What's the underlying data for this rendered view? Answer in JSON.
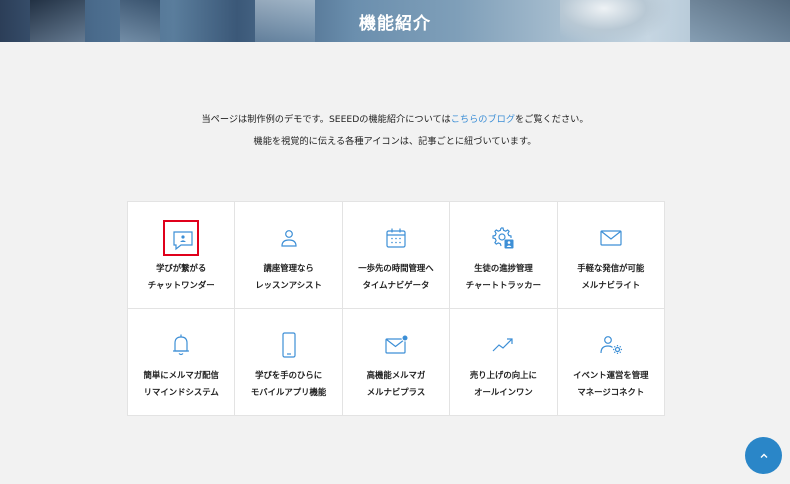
{
  "banner": {
    "title": "機能紹介"
  },
  "intro": {
    "line1_before": "当ページは制作例のデモです。SEEEDの機能紹介については",
    "line1_link": "こちらのブログ",
    "line1_after": "をご覧ください。",
    "line2": "機能を視覚的に伝える各種アイコンは、記事ごとに紐づいています。"
  },
  "features": [
    {
      "line1": "学びが繋がる",
      "line2": "チャットワンダー",
      "icon": "chat-user-icon"
    },
    {
      "line1": "講座管理なら",
      "line2": "レッスンアシスト",
      "icon": "user-icon"
    },
    {
      "line1": "一歩先の時間管理へ",
      "line2": "タイムナビゲータ",
      "icon": "calendar-icon"
    },
    {
      "line1": "生徒の進捗管理",
      "line2": "チャートトラッカー",
      "icon": "gear-user-icon"
    },
    {
      "line1": "手軽な発信が可能",
      "line2": "メルナビライト",
      "icon": "mail-icon"
    },
    {
      "line1": "簡単にメルマガ配信",
      "line2": "リマインドシステム",
      "icon": "bell-icon"
    },
    {
      "line1": "学びを手のひらに",
      "line2": "モバイルアプリ機能",
      "icon": "smartphone-icon"
    },
    {
      "line1": "高機能メルマガ",
      "line2": "メルナビプラス",
      "icon": "mail-notification-icon"
    },
    {
      "line1": "売り上げの向上に",
      "line2": "オールインワン",
      "icon": "trend-up-icon"
    },
    {
      "line1": "イベント運営を管理",
      "line2": "マネージコネクト",
      "icon": "user-gear-icon"
    }
  ],
  "colors": {
    "accent": "#2a86c8",
    "icon_stroke": "#3d8fd6",
    "highlight": "#e0001b",
    "link": "#3d8fd6"
  }
}
